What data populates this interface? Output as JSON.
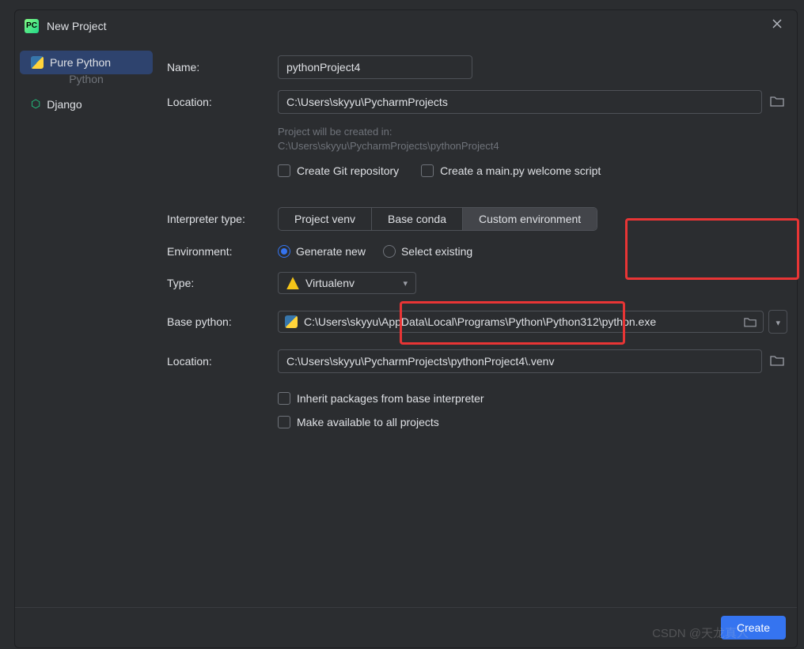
{
  "window": {
    "title": "New Project"
  },
  "sidebar": {
    "items": [
      {
        "label": "Pure Python",
        "selected": true
      },
      {
        "label": "Django",
        "selected": false
      }
    ],
    "ghost_label": "Python"
  },
  "form": {
    "name_label": "Name:",
    "name_value": "pythonProject4",
    "location_label": "Location:",
    "location_value": "C:\\Users\\skyyu\\PycharmProjects",
    "hint_line1": "Project will be created in:",
    "hint_line2": "C:\\Users\\skyyu\\PycharmProjects\\pythonProject4",
    "git_label": "Create Git repository",
    "welcome_label": "Create a main.py welcome script",
    "interpreter_type_label": "Interpreter type:",
    "interp_options": {
      "venv": "Project venv",
      "conda": "Base conda",
      "custom": "Custom environment"
    },
    "env_label": "Environment:",
    "env_generate": "Generate new",
    "env_select": "Select existing",
    "type_label": "Type:",
    "type_value": "Virtualenv",
    "base_python_label": "Base python:",
    "base_python_value": "C:\\Users\\skyyu\\AppData\\Local\\Programs\\Python\\Python312\\python.exe",
    "venv_location_label": "Location:",
    "venv_location_value": "C:\\Users\\skyyu\\PycharmProjects\\pythonProject4\\.venv",
    "inherit_label": "Inherit packages from base interpreter",
    "make_avail_label": "Make available to all projects"
  },
  "footer": {
    "create_label": "Create"
  },
  "watermark": "CSDN @天龙真人"
}
